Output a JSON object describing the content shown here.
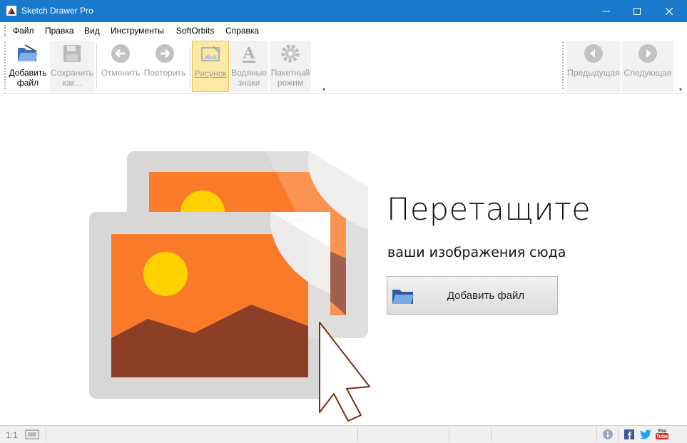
{
  "window": {
    "title": "Sketch Drawer Pro"
  },
  "menu": {
    "file": "Файл",
    "edit": "Правка",
    "view": "Вид",
    "tools": "Инструменты",
    "softorbits": "SoftOrbits",
    "help": "Справка"
  },
  "toolbar": {
    "add_file_l1": "Добавить",
    "add_file_l2": "файл",
    "save_as_l1": "Сохранить",
    "save_as_l2": "как...",
    "undo": "Отменить",
    "redo": "Повторить",
    "picture": "Рисунок",
    "watermarks_l1": "Водяные",
    "watermarks_l2": "знаки",
    "batch_l1": "Пакетный",
    "batch_l2": "режим",
    "previous": "Предыдущая",
    "next": "Следующая"
  },
  "dropzone": {
    "headline": "Перетащите",
    "subline": "ваши изображения сюда",
    "add_button": "Добавить файл"
  },
  "status": {
    "zoom": "1:1"
  },
  "colors": {
    "titlebar": "#1979ca",
    "photo_orange": "#fb7a2a",
    "sun": "#ffd100",
    "mountain": "#8c3e27",
    "frame": "#d9d7d5"
  }
}
